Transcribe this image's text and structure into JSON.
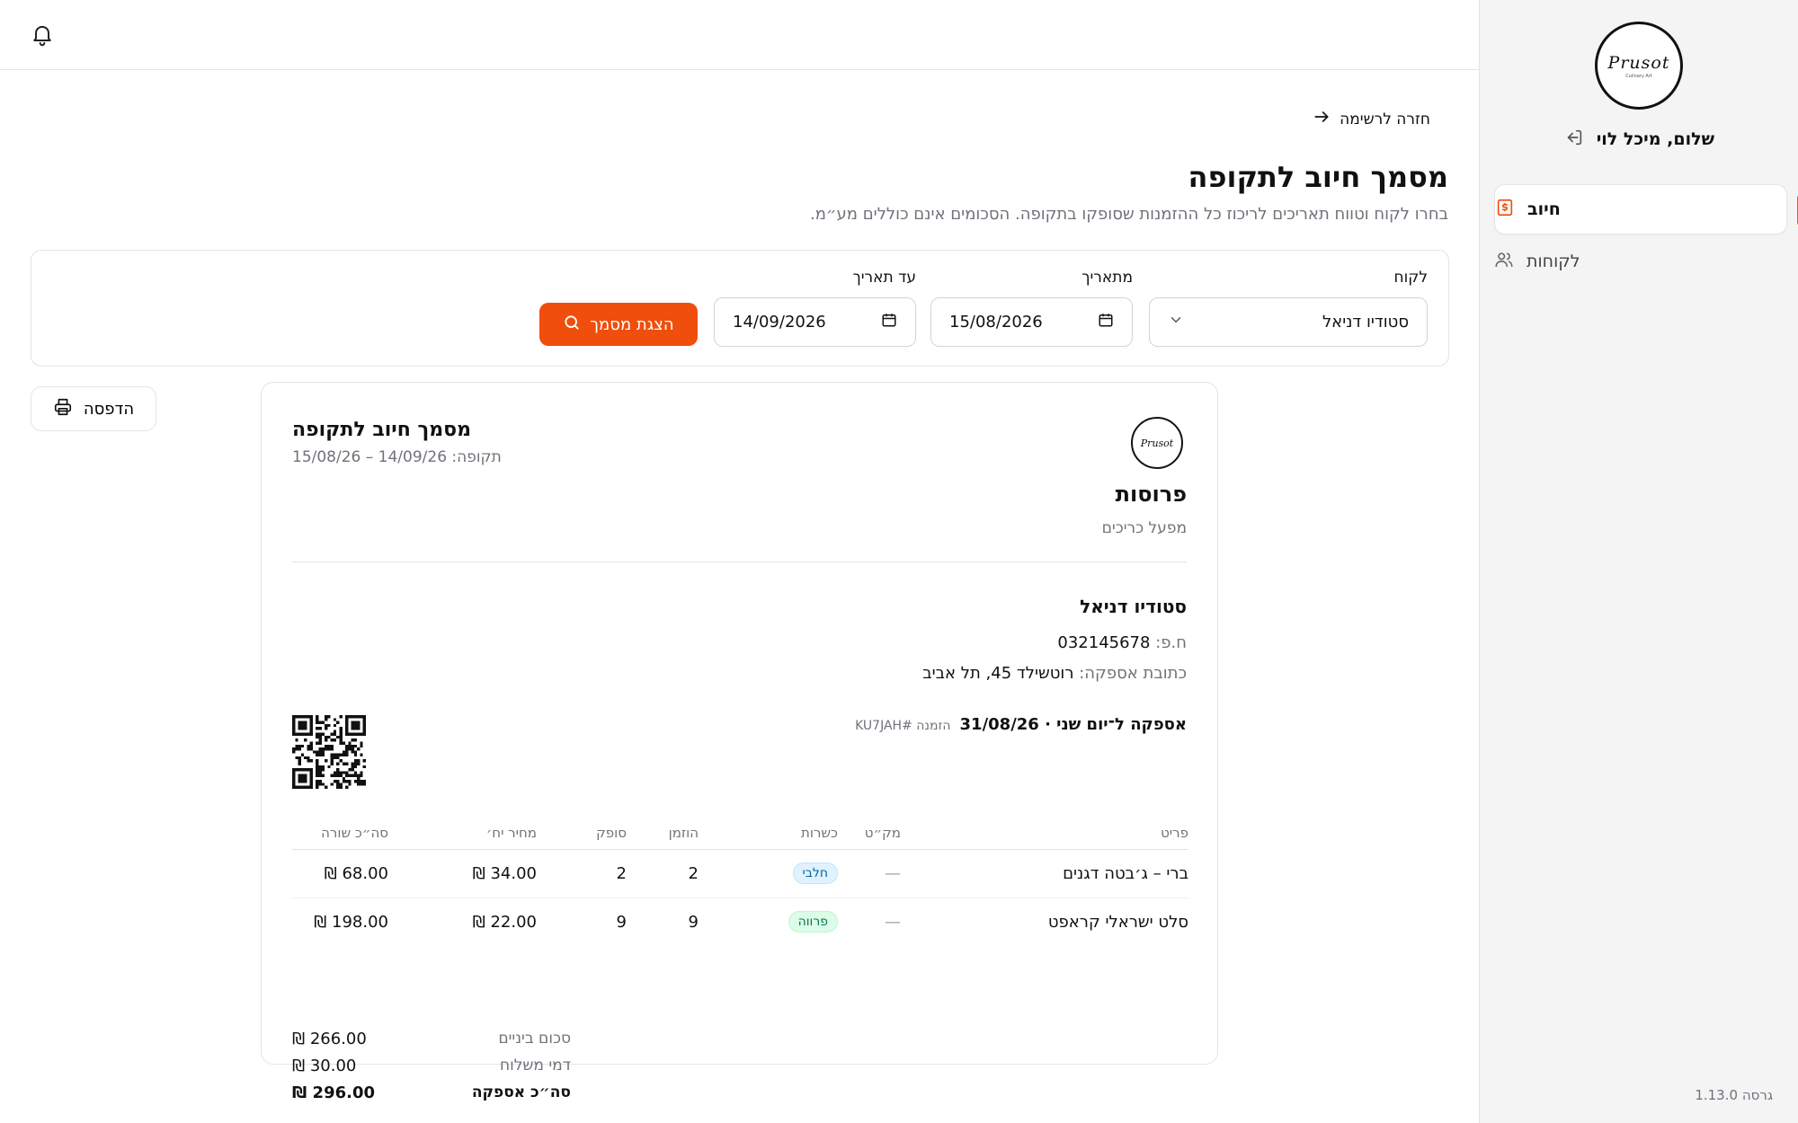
{
  "sidebar": {
    "logo_text": "Prusot",
    "logo_sub": "Culinary Art",
    "greeting": "שלום, מיכל לוי",
    "nav": [
      {
        "label": "חיוב",
        "icon": "billing-icon",
        "active": true
      },
      {
        "label": "לקוחות",
        "icon": "users-icon",
        "active": false
      }
    ],
    "version": "גרסה 1.13.0"
  },
  "main": {
    "back_label": "חזרה לרשימה",
    "title": "מסמך חיוב לתקופה",
    "description": "בחרו לקוח וטווח תאריכים לריכוז כל ההזמנות שסופקו בתקופה. הסכומים אינם כוללים מע״מ.",
    "filters": {
      "customer_label": "לקוח",
      "customer_value": "סטודיו דניאל",
      "from_label": "מתאריך",
      "from_value": "15/08/2026",
      "to_label": "עד תאריך",
      "to_value": "14/09/2026",
      "show_button": "הצגת מסמך"
    },
    "print_button": "הדפסה"
  },
  "document": {
    "logo_text": "Prusot",
    "company_name": "פרוסות",
    "company_tagline": "מפעל כריכים",
    "title": "מסמך חיוב לתקופה",
    "period_label": "תקופה:",
    "period_value": "15/08/26 – 14/09/26",
    "customer": {
      "name": "סטודיו דניאל",
      "id_label": "ח.פ:",
      "id_value": "032145678",
      "address_label": "כתובת אספקה:",
      "address_value": "רוטשילד 45, תל אביב"
    },
    "delivery": {
      "title": "אספקה ל־יום שני · 31/08/26",
      "order_ref": "הזמנה #KU7JAH"
    },
    "table": {
      "headers": {
        "item": "פריט",
        "sku": "מק״ט",
        "kosher": "כשרות",
        "ordered": "הוזמן",
        "supplied": "סופק",
        "unit_price": "מחיר יח׳",
        "line_total": "סה״כ שורה"
      },
      "rows": [
        {
          "item": "ברי – ג׳בטה דגנים",
          "sku": "—",
          "kosher": "חלבי",
          "ordered": "2",
          "supplied": "2",
          "unit_price": "₪ 34.00",
          "line_total": "₪ 68.00"
        },
        {
          "item": "סלט ישראלי קראפט",
          "sku": "—",
          "kosher": "פרווה",
          "ordered": "9",
          "supplied": "9",
          "unit_price": "₪ 22.00",
          "line_total": "₪ 198.00"
        }
      ]
    },
    "totals": {
      "subtotal_label": "סכום ביניים",
      "subtotal_value": "₪ 266.00",
      "delivery_label": "דמי משלוח",
      "delivery_value": "₪ 30.00",
      "total_label": "סה״כ אספקה",
      "total_value": "₪ 296.00"
    }
  },
  "colors": {
    "accent": "#f04e0c",
    "dairy_badge": "#e0f2fe",
    "parve_badge": "#dcfce7"
  }
}
